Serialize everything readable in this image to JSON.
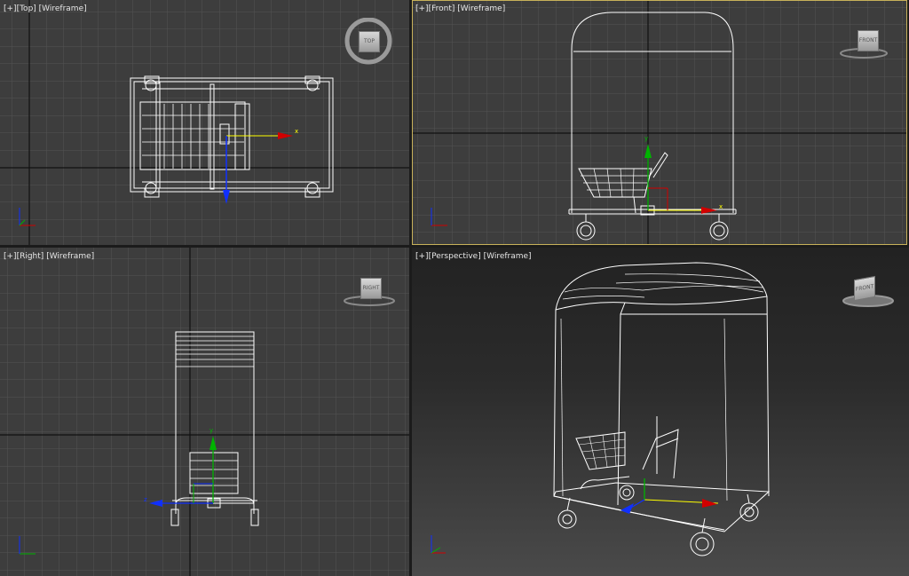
{
  "viewports": {
    "top": {
      "plus": "[+]",
      "view": "[Top]",
      "shading": "[Wireframe]",
      "cube": "TOP"
    },
    "front": {
      "plus": "[+]",
      "view": "[Front]",
      "shading": "[Wireframe]",
      "cube": "FRONT"
    },
    "right": {
      "plus": "[+]",
      "view": "[Right]",
      "shading": "[Wireframe]",
      "cube": "RIGHT"
    },
    "perspective": {
      "plus": "[+]",
      "view": "[Perspective]",
      "shading": "[Wireframe]",
      "cube": "FRONT"
    }
  },
  "gizmo_labels": {
    "x": "x",
    "y": "y",
    "z": "z"
  },
  "colors": {
    "grid": "#505050",
    "axis": "#111111",
    "wire": "#ffffff",
    "active_border": "#c7b15a",
    "x_axis": "#d10000",
    "y_axis": "#00b400",
    "z_axis": "#1030ff",
    "gizmo_yellow": "#ffff00"
  }
}
